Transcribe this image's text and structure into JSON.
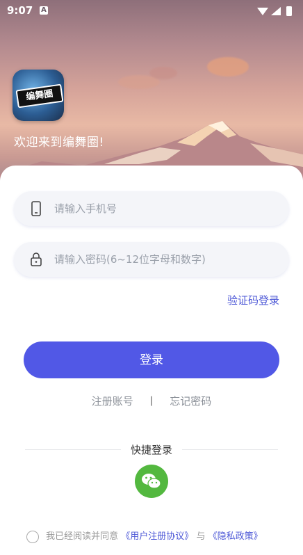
{
  "status": {
    "time": "9:07",
    "notification_badge": "A"
  },
  "header": {
    "welcome": "欢迎来到编舞圈!",
    "logo_text": "编舞圈"
  },
  "form": {
    "phone_placeholder": "请输入手机号",
    "password_placeholder": "请输入密码(6~12位字母和数字)",
    "sms_login": "验证码登录",
    "login_button": "登录"
  },
  "links": {
    "register": "注册账号",
    "separator": "丨",
    "forgot": "忘记密码"
  },
  "quick_login": {
    "title": "快捷登录"
  },
  "agreement": {
    "prefix": "我已经阅读并同意",
    "user_agreement": "《用户注册协议》",
    "and": "与",
    "privacy_policy": "《隐私政策》"
  },
  "colors": {
    "primary": "#5158e6",
    "link": "#4a55d6",
    "wechat": "#53b83f"
  }
}
